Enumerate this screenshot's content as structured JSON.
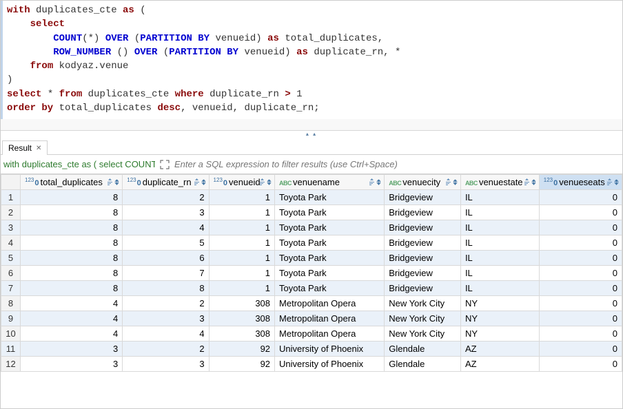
{
  "sql": {
    "tokens": [
      [
        [
          "kw-brown",
          "with"
        ],
        [
          "kw-plain",
          " duplicates_cte "
        ],
        [
          "kw-brown",
          "as"
        ],
        [
          "kw-plain",
          " ("
        ]
      ],
      [
        [
          "kw-plain",
          "    "
        ],
        [
          "kw-brown",
          "select"
        ]
      ],
      [
        [
          "kw-plain",
          "        "
        ],
        [
          "kw-blue",
          "COUNT"
        ],
        [
          "kw-plain",
          "(*) "
        ],
        [
          "kw-blue",
          "OVER"
        ],
        [
          "kw-plain",
          " ("
        ],
        [
          "kw-blue",
          "PARTITION BY"
        ],
        [
          "kw-plain",
          " venueid) "
        ],
        [
          "kw-brown",
          "as"
        ],
        [
          "kw-plain",
          " total_duplicates,"
        ]
      ],
      [
        [
          "kw-plain",
          "        "
        ],
        [
          "kw-blue",
          "ROW_NUMBER"
        ],
        [
          "kw-plain",
          " () "
        ],
        [
          "kw-blue",
          "OVER"
        ],
        [
          "kw-plain",
          " ("
        ],
        [
          "kw-blue",
          "PARTITION BY"
        ],
        [
          "kw-plain",
          " venueid) "
        ],
        [
          "kw-brown",
          "as"
        ],
        [
          "kw-plain",
          " duplicate_rn, *"
        ]
      ],
      [
        [
          "kw-plain",
          "    "
        ],
        [
          "kw-brown",
          "from"
        ],
        [
          "kw-plain",
          " kodyaz.venue"
        ]
      ],
      [
        [
          "kw-plain",
          ")"
        ]
      ],
      [
        [
          "kw-brown",
          "select"
        ],
        [
          "kw-plain",
          " * "
        ],
        [
          "kw-brown",
          "from"
        ],
        [
          "kw-plain",
          " duplicates_cte "
        ],
        [
          "kw-brown",
          "where"
        ],
        [
          "kw-plain",
          " duplicate_rn "
        ],
        [
          "kw-op",
          ">"
        ],
        [
          "kw-plain",
          " 1"
        ]
      ],
      [
        [
          "kw-brown",
          "order by"
        ],
        [
          "kw-plain",
          " total_duplicates "
        ],
        [
          "kw-brown",
          "desc"
        ],
        [
          "kw-plain",
          ", venueid, duplicate_rn;"
        ]
      ]
    ]
  },
  "result_tab": {
    "label": "Result",
    "close_glyph": "✕"
  },
  "filterbar": {
    "caption": "with duplicates_cte as ( select COUNT(*) O",
    "filter_placeholder": "Enter a SQL expression to filter results (use Ctrl+Space)"
  },
  "grid": {
    "columns": [
      {
        "key": "total_duplicates",
        "label": "total_duplicates",
        "type": "num",
        "selected": false
      },
      {
        "key": "duplicate_rn",
        "label": "duplicate_rn",
        "type": "num",
        "selected": false
      },
      {
        "key": "venueid",
        "label": "venueid",
        "type": "num",
        "selected": false
      },
      {
        "key": "venuename",
        "label": "venuename",
        "type": "text",
        "selected": false
      },
      {
        "key": "venuecity",
        "label": "venuecity",
        "type": "text",
        "selected": false
      },
      {
        "key": "venuestate",
        "label": "venuestate",
        "type": "text",
        "selected": false
      },
      {
        "key": "venueseats",
        "label": "venueseats",
        "type": "num",
        "selected": true
      }
    ],
    "rows": [
      {
        "n": 1,
        "total_duplicates": 8,
        "duplicate_rn": 2,
        "venueid": 1,
        "venuename": "Toyota Park",
        "venuecity": "Bridgeview",
        "venuestate": "IL",
        "venueseats": 0
      },
      {
        "n": 2,
        "total_duplicates": 8,
        "duplicate_rn": 3,
        "venueid": 1,
        "venuename": "Toyota Park",
        "venuecity": "Bridgeview",
        "venuestate": "IL",
        "venueseats": 0
      },
      {
        "n": 3,
        "total_duplicates": 8,
        "duplicate_rn": 4,
        "venueid": 1,
        "venuename": "Toyota Park",
        "venuecity": "Bridgeview",
        "venuestate": "IL",
        "venueseats": 0
      },
      {
        "n": 4,
        "total_duplicates": 8,
        "duplicate_rn": 5,
        "venueid": 1,
        "venuename": "Toyota Park",
        "venuecity": "Bridgeview",
        "venuestate": "IL",
        "venueseats": 0
      },
      {
        "n": 5,
        "total_duplicates": 8,
        "duplicate_rn": 6,
        "venueid": 1,
        "venuename": "Toyota Park",
        "venuecity": "Bridgeview",
        "venuestate": "IL",
        "venueseats": 0
      },
      {
        "n": 6,
        "total_duplicates": 8,
        "duplicate_rn": 7,
        "venueid": 1,
        "venuename": "Toyota Park",
        "venuecity": "Bridgeview",
        "venuestate": "IL",
        "venueseats": 0
      },
      {
        "n": 7,
        "total_duplicates": 8,
        "duplicate_rn": 8,
        "venueid": 1,
        "venuename": "Toyota Park",
        "venuecity": "Bridgeview",
        "venuestate": "IL",
        "venueseats": 0
      },
      {
        "n": 8,
        "total_duplicates": 4,
        "duplicate_rn": 2,
        "venueid": 308,
        "venuename": "Metropolitan Opera",
        "venuecity": "New York City",
        "venuestate": "NY",
        "venueseats": 0
      },
      {
        "n": 9,
        "total_duplicates": 4,
        "duplicate_rn": 3,
        "venueid": 308,
        "venuename": "Metropolitan Opera",
        "venuecity": "New York City",
        "venuestate": "NY",
        "venueseats": 0
      },
      {
        "n": 10,
        "total_duplicates": 4,
        "duplicate_rn": 4,
        "venueid": 308,
        "venuename": "Metropolitan Opera",
        "venuecity": "New York City",
        "venuestate": "NY",
        "venueseats": 0
      },
      {
        "n": 11,
        "total_duplicates": 3,
        "duplicate_rn": 2,
        "venueid": 92,
        "venuename": "University of Phoenix",
        "venuecity": "Glendale",
        "venuestate": "AZ",
        "venueseats": 0
      },
      {
        "n": 12,
        "total_duplicates": 3,
        "duplicate_rn": 3,
        "venueid": 92,
        "venuename": "University of Phoenix",
        "venuecity": "Glendale",
        "venuestate": "AZ",
        "venueseats": 0
      }
    ]
  }
}
